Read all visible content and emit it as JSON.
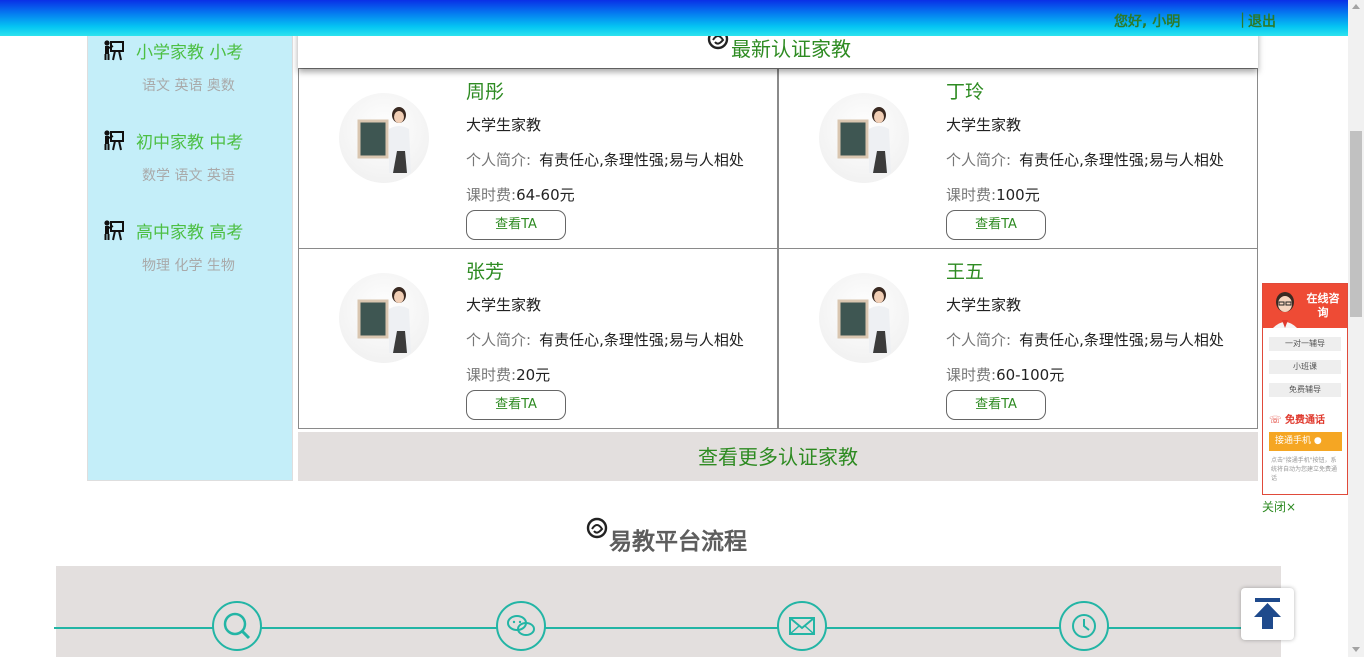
{
  "header": {
    "greeting": "您好, 小明",
    "separator": "|",
    "logout": "退出"
  },
  "sidebar": {
    "categories": [
      {
        "title": "小学家教 小考",
        "subjects": "语文 英语 奥数"
      },
      {
        "title": "初中家教 中考",
        "subjects": "数学 语文 英语"
      },
      {
        "title": "高中家教 高考",
        "subjects": "物理 化学 生物"
      }
    ]
  },
  "latest": {
    "title": "最新认证家教",
    "intro_label": "个人简介:",
    "fee_label": "课时费:",
    "view_label": "查看TA",
    "more_label": "查看更多认证家教",
    "tutors": [
      {
        "name": "周彤",
        "level": "大学生家教",
        "intro": "有责任心,条理性强;易与人相处",
        "fee": "64-60元"
      },
      {
        "name": "丁玲",
        "level": "大学生家教",
        "intro": "有责任心,条理性强;易与人相处",
        "fee": "100元"
      },
      {
        "name": "张芳",
        "level": "大学生家教",
        "intro": "有责任心,条理性强;易与人相处",
        "fee": "20元"
      },
      {
        "name": "王五",
        "level": "大学生家教",
        "intro": "有责任心,条理性强;易与人相处",
        "fee": "60-100元"
      }
    ]
  },
  "process": {
    "title": "易教平台流程",
    "steps": [
      "search-icon",
      "wechat-icon",
      "envelope-icon",
      "clock-icon"
    ]
  },
  "float_panel": {
    "head": "在线咨询",
    "options": [
      "一对一辅导",
      "小班课",
      "免费辅导"
    ],
    "call": "免费通话",
    "phone_button": "接通手机",
    "tip": "点击\"接通手机\"按钮，系统将自动为您建立免费通话",
    "close": "关闭×"
  },
  "colors": {
    "accent_green": "#2e8b22",
    "sidebar_bg": "#c4eef9",
    "teal": "#23b5a5",
    "band_bg": "#e3dfde"
  }
}
